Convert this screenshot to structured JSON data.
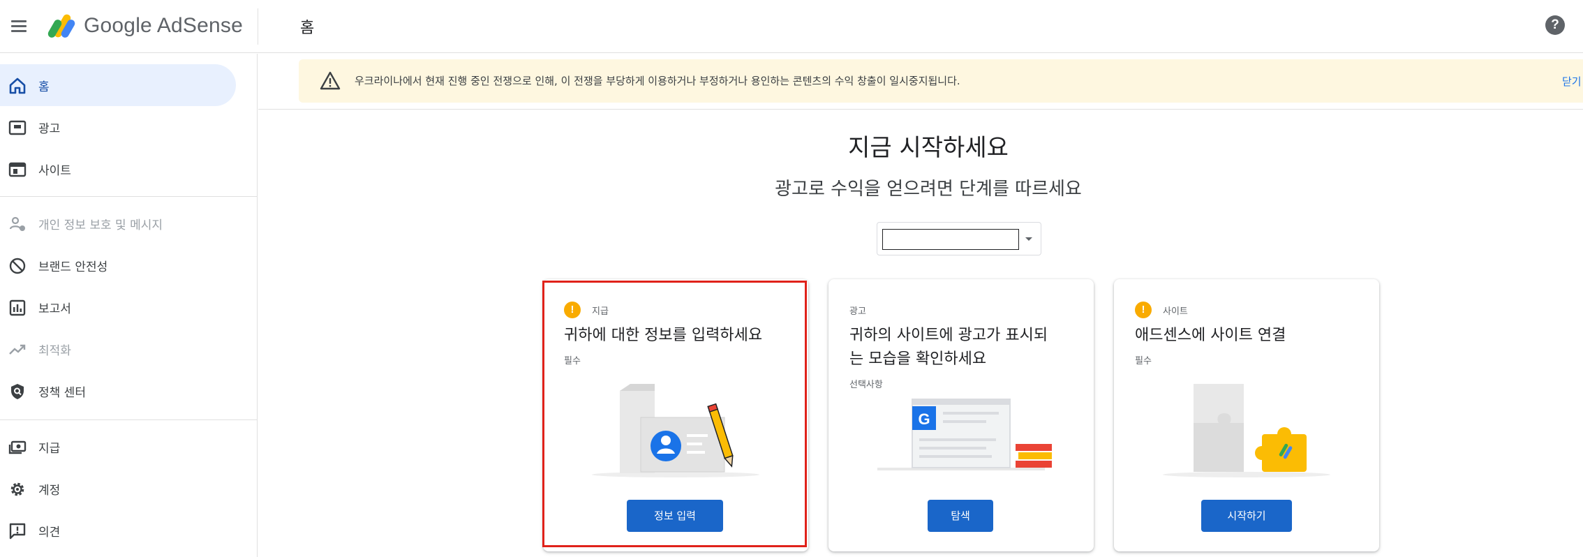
{
  "header": {
    "product_name": "Google AdSense",
    "page_title": "홈",
    "help_label": "?"
  },
  "sidebar": {
    "items": [
      {
        "label": "홈",
        "icon": "home-icon",
        "active": true
      },
      {
        "label": "광고",
        "icon": "ads-icon"
      },
      {
        "label": "사이트",
        "icon": "sites-icon"
      },
      {
        "label": "개인 정보 보호 및 메시지",
        "icon": "privacy-icon",
        "disabled": true
      },
      {
        "label": "브랜드 안전성",
        "icon": "block-icon"
      },
      {
        "label": "보고서",
        "icon": "reports-icon"
      },
      {
        "label": "최적화",
        "icon": "trending-icon",
        "disabled": true
      },
      {
        "label": "정책 센터",
        "icon": "policy-icon"
      },
      {
        "label": "지급",
        "icon": "payments-icon"
      },
      {
        "label": "계정",
        "icon": "gear-icon"
      },
      {
        "label": "의견",
        "icon": "feedback-icon"
      }
    ]
  },
  "banner": {
    "text": "우크라이나에서 현재 진행 중인 전쟁으로 인해, 이 전쟁을 부당하게 이용하거나 부정하거나 용인하는 콘텐츠의 수익 창출이 일시중지됩니다.",
    "close_label": "닫기"
  },
  "hero": {
    "title": "지금 시작하세요",
    "subtitle": "광고로 수익을 얻으려면 단계를 따르세요"
  },
  "site_select": {
    "value": ""
  },
  "cards": [
    {
      "tag": "지급",
      "title": "귀하에 대한 정보를 입력하세요",
      "note": "필수",
      "button": "정보 입력"
    },
    {
      "tag": "광고",
      "title": "귀하의 사이트에 광고가 표시되는 모습을 확인하세요",
      "title_lines": [
        "귀하의 사이트에 광고가 표시되",
        "는 모습을 확인하세요"
      ],
      "note": "선택사항",
      "button": "탐색"
    },
    {
      "tag": "사이트",
      "title": "애드센스에 사이트 연결",
      "note": "필수",
      "button": "시작하기"
    }
  ],
  "colors": {
    "accent": "#1a66c9",
    "banner_bg": "#fef7e0",
    "active_nav_bg": "#e8f0fe",
    "warning_dot": "#f9ab00",
    "highlight": "#e0221a"
  }
}
